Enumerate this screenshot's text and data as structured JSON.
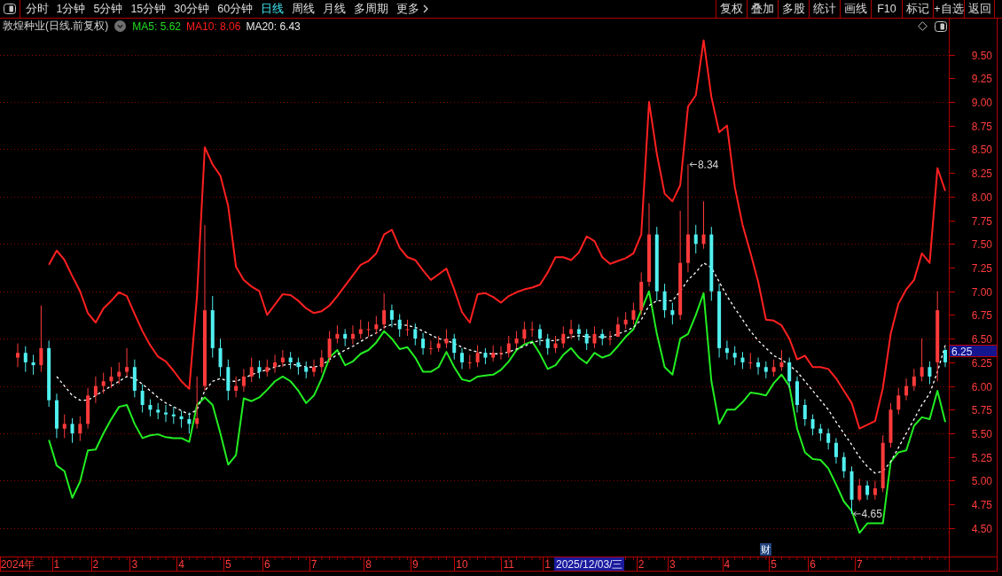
{
  "period_tabs": [
    {
      "label": "分时",
      "selected": false
    },
    {
      "label": "1分钟",
      "selected": false
    },
    {
      "label": "5分钟",
      "selected": false
    },
    {
      "label": "15分钟",
      "selected": false
    },
    {
      "label": "30分钟",
      "selected": false
    },
    {
      "label": "60分钟",
      "selected": false
    },
    {
      "label": "日线",
      "selected": true
    },
    {
      "label": "周线",
      "selected": false
    },
    {
      "label": "月线",
      "selected": false
    },
    {
      "label": "多周期",
      "selected": false
    }
  ],
  "more_menu": {
    "label": "更多"
  },
  "tool_buttons": [
    "复权",
    "叠加",
    "多股",
    "统计",
    "画线",
    "F10",
    "标记",
    "+自选",
    "返回"
  ],
  "header": {
    "title": "敦煌种业(日线.前复权)",
    "indicators": [
      {
        "label": "MA5: 5.62",
        "color": "#22dd22"
      },
      {
        "label": "MA10: 8.06",
        "color": "#ff1c1c"
      },
      {
        "label": "MA20: 6.43",
        "color": "#e8e8e8"
      }
    ]
  },
  "chart": {
    "chart_data": [
      {
        "type": "candlestick",
        "categories": [
          "2024年",
          null,
          null,
          null,
          null,
          "1",
          null,
          null,
          null,
          null,
          "2",
          null,
          null,
          null,
          null,
          "3",
          null,
          null,
          null,
          null,
          null,
          "4",
          null,
          null,
          null,
          null,
          null,
          "5",
          null,
          null,
          null,
          null,
          "6",
          null,
          null,
          null,
          null,
          null,
          "7",
          null,
          null,
          null,
          null,
          null,
          null,
          "8",
          null,
          null,
          null,
          null,
          null,
          "9",
          null,
          null,
          null,
          null,
          null,
          "10",
          null,
          null,
          null,
          null,
          null,
          "11",
          null,
          null,
          null,
          null,
          "1",
          null,
          null,
          null,
          null,
          null,
          null,
          null,
          null,
          null,
          null,
          null,
          "2",
          null,
          null,
          null,
          "3",
          null,
          null,
          null,
          null,
          null,
          null,
          "4",
          null,
          null,
          null,
          null,
          null,
          "5",
          null,
          null,
          null,
          null,
          "6",
          null,
          null,
          null,
          null,
          null,
          "7",
          null,
          null,
          null,
          null,
          null,
          null,
          null,
          null,
          null,
          null,
          null
        ],
        "ohlc": [
          [
            6.3,
            6.45,
            6.2,
            6.35
          ],
          [
            6.35,
            6.42,
            6.15,
            6.25
          ],
          [
            6.25,
            6.33,
            6.12,
            6.22
          ],
          [
            6.22,
            6.85,
            6.15,
            6.4
          ],
          [
            6.4,
            6.48,
            5.78,
            5.85
          ],
          [
            5.85,
            5.92,
            5.45,
            5.55
          ],
          [
            5.55,
            5.7,
            5.45,
            5.6
          ],
          [
            5.6,
            5.66,
            5.4,
            5.5
          ],
          [
            5.5,
            5.68,
            5.42,
            5.6
          ],
          [
            5.6,
            5.98,
            5.55,
            5.9
          ],
          [
            5.9,
            6.1,
            5.82,
            6.0
          ],
          [
            6.0,
            6.14,
            5.92,
            6.05
          ],
          [
            6.05,
            6.2,
            5.98,
            6.1
          ],
          [
            6.1,
            6.25,
            6.02,
            6.15
          ],
          [
            6.15,
            6.4,
            6.1,
            6.2
          ],
          [
            6.2,
            6.28,
            5.88,
            5.95
          ],
          [
            5.95,
            6.02,
            5.72,
            5.8
          ],
          [
            5.8,
            5.86,
            5.68,
            5.75
          ],
          [
            5.75,
            5.82,
            5.65,
            5.72
          ],
          [
            5.72,
            5.8,
            5.62,
            5.7
          ],
          [
            5.7,
            5.78,
            5.6,
            5.68
          ],
          [
            5.68,
            5.74,
            5.56,
            5.65
          ],
          [
            5.65,
            5.72,
            5.5,
            5.6
          ],
          [
            5.6,
            6.1,
            5.55,
            5.66
          ],
          [
            6.0,
            7.7,
            5.95,
            6.8
          ],
          [
            6.8,
            6.95,
            6.3,
            6.4
          ],
          [
            6.4,
            6.5,
            6.1,
            6.2
          ],
          [
            6.2,
            6.28,
            5.85,
            5.95
          ],
          [
            5.95,
            6.1,
            5.88,
            6.0
          ],
          [
            6.0,
            6.18,
            5.94,
            6.1
          ],
          [
            6.1,
            6.3,
            6.04,
            6.2
          ],
          [
            6.2,
            6.27,
            6.08,
            6.15
          ],
          [
            6.15,
            6.28,
            6.1,
            6.2
          ],
          [
            6.2,
            6.33,
            6.14,
            6.25
          ],
          [
            6.25,
            6.38,
            6.2,
            6.3
          ],
          [
            6.3,
            6.36,
            6.18,
            6.25
          ],
          [
            6.25,
            6.3,
            6.12,
            6.2
          ],
          [
            6.2,
            6.26,
            6.08,
            6.15
          ],
          [
            6.15,
            6.28,
            6.1,
            6.2
          ],
          [
            6.2,
            6.38,
            6.14,
            6.3
          ],
          [
            6.3,
            6.58,
            6.25,
            6.5
          ],
          [
            6.5,
            6.64,
            6.45,
            6.55
          ],
          [
            6.55,
            6.6,
            6.42,
            6.5
          ],
          [
            6.5,
            6.64,
            6.44,
            6.55
          ],
          [
            6.55,
            6.7,
            6.5,
            6.6
          ],
          [
            6.6,
            6.68,
            6.52,
            6.6
          ],
          [
            6.6,
            6.74,
            6.55,
            6.65
          ],
          [
            6.65,
            6.98,
            6.6,
            6.8
          ],
          [
            6.8,
            6.86,
            6.62,
            6.7
          ],
          [
            6.7,
            6.76,
            6.52,
            6.6
          ],
          [
            6.6,
            6.7,
            6.53,
            6.6
          ],
          [
            6.6,
            6.66,
            6.43,
            6.5
          ],
          [
            6.5,
            6.56,
            6.33,
            6.4
          ],
          [
            6.4,
            6.48,
            6.33,
            6.4
          ],
          [
            6.4,
            6.53,
            6.36,
            6.45
          ],
          [
            6.45,
            6.6,
            6.4,
            6.5
          ],
          [
            6.5,
            6.55,
            6.28,
            6.35
          ],
          [
            6.35,
            6.4,
            6.18,
            6.25
          ],
          [
            6.25,
            6.33,
            6.18,
            6.25
          ],
          [
            6.25,
            6.43,
            6.2,
            6.35
          ],
          [
            6.35,
            6.4,
            6.23,
            6.3
          ],
          [
            6.3,
            6.43,
            6.26,
            6.35
          ],
          [
            6.35,
            6.42,
            6.28,
            6.35
          ],
          [
            6.35,
            6.53,
            6.3,
            6.45
          ],
          [
            6.45,
            6.58,
            6.4,
            6.5
          ],
          [
            6.5,
            6.68,
            6.45,
            6.6
          ],
          [
            6.6,
            6.68,
            6.52,
            6.6
          ],
          [
            6.6,
            6.65,
            6.43,
            6.5
          ],
          [
            6.5,
            6.55,
            6.33,
            6.4
          ],
          [
            6.4,
            6.53,
            6.35,
            6.45
          ],
          [
            6.45,
            6.63,
            6.4,
            6.55
          ],
          [
            6.55,
            6.7,
            6.5,
            6.6
          ],
          [
            6.6,
            6.65,
            6.48,
            6.55
          ],
          [
            6.55,
            6.6,
            6.38,
            6.45
          ],
          [
            6.45,
            6.63,
            6.4,
            6.55
          ],
          [
            6.55,
            6.6,
            6.43,
            6.5
          ],
          [
            6.5,
            6.58,
            6.43,
            6.5
          ],
          [
            6.52,
            6.73,
            6.52,
            6.65
          ],
          [
            6.65,
            6.78,
            6.6,
            6.7
          ],
          [
            6.7,
            6.88,
            6.65,
            6.8
          ],
          [
            6.8,
            7.2,
            6.75,
            7.1
          ],
          [
            7.1,
            7.93,
            7.05,
            7.6
          ],
          [
            7.6,
            7.68,
            6.9,
            7.0
          ],
          [
            7.0,
            7.08,
            6.72,
            6.8
          ],
          [
            6.8,
            6.88,
            6.65,
            6.75
          ],
          [
            6.75,
            7.85,
            6.7,
            7.3
          ],
          [
            7.3,
            8.34,
            7.2,
            7.6
          ],
          [
            7.6,
            7.7,
            7.4,
            7.5
          ],
          [
            7.5,
            7.95,
            7.45,
            7.6
          ],
          [
            7.6,
            7.68,
            6.9,
            7.0
          ],
          [
            7.0,
            7.08,
            6.3,
            6.4
          ],
          [
            6.4,
            6.48,
            6.28,
            6.35
          ],
          [
            6.35,
            6.42,
            6.22,
            6.3
          ],
          [
            6.3,
            6.36,
            6.18,
            6.25
          ],
          [
            6.25,
            6.35,
            6.18,
            6.25
          ],
          [
            6.25,
            6.3,
            6.12,
            6.2
          ],
          [
            6.2,
            6.26,
            6.08,
            6.15
          ],
          [
            6.15,
            6.28,
            6.1,
            6.2
          ],
          [
            6.2,
            6.38,
            6.16,
            6.25
          ],
          [
            6.25,
            6.3,
            5.98,
            6.05
          ],
          [
            6.05,
            6.1,
            5.72,
            5.8
          ],
          [
            5.8,
            5.86,
            5.58,
            5.65
          ],
          [
            5.65,
            5.7,
            5.48,
            5.55
          ],
          [
            5.55,
            5.6,
            5.42,
            5.5
          ],
          [
            5.5,
            5.55,
            5.33,
            5.4
          ],
          [
            5.4,
            5.45,
            5.18,
            5.25
          ],
          [
            5.25,
            5.3,
            5.03,
            5.1
          ],
          [
            5.1,
            5.15,
            4.65,
            4.8
          ],
          [
            4.8,
            5.02,
            4.78,
            4.95
          ],
          [
            4.95,
            5.0,
            4.8,
            4.85
          ],
          [
            4.85,
            5.0,
            4.8,
            4.92
          ],
          [
            4.92,
            5.48,
            4.88,
            5.4
          ],
          [
            5.4,
            5.82,
            5.35,
            5.75
          ],
          [
            5.75,
            5.98,
            5.7,
            5.9
          ],
          [
            5.9,
            6.08,
            5.85,
            6.0
          ],
          [
            6.0,
            6.18,
            5.95,
            6.1
          ],
          [
            6.1,
            6.5,
            6.05,
            6.2
          ],
          [
            6.2,
            6.26,
            6.02,
            6.1
          ],
          [
            6.25,
            7.0,
            6.05,
            6.8
          ],
          [
            6.38,
            6.4,
            6.2,
            6.25
          ]
        ],
        "series": [
          {
            "type": "line",
            "color": "#22ee22",
            "values": [
              null,
              null,
              null,
              null,
              5.43,
              5.16,
              5.1,
              4.82,
              4.99,
              5.32,
              5.33,
              5.5,
              5.65,
              5.78,
              5.8,
              5.6,
              5.45,
              5.48,
              5.49,
              5.46,
              5.45,
              5.45,
              5.41,
              5.8,
              5.88,
              5.8,
              5.5,
              5.17,
              5.27,
              5.87,
              5.84,
              5.88,
              5.96,
              6.05,
              6.1,
              6.05,
              5.95,
              5.82,
              5.9,
              6.08,
              6.3,
              6.38,
              6.22,
              6.26,
              6.34,
              6.38,
              6.46,
              6.58,
              6.5,
              6.39,
              6.41,
              6.3,
              6.15,
              6.15,
              6.2,
              6.36,
              6.2,
              6.07,
              6.05,
              6.1,
              6.11,
              6.12,
              6.17,
              6.26,
              6.38,
              6.44,
              6.47,
              6.34,
              6.18,
              6.22,
              6.33,
              6.4,
              6.3,
              6.24,
              6.35,
              6.3,
              6.33,
              6.42,
              6.52,
              6.6,
              6.8,
              7.0,
              6.55,
              6.2,
              6.12,
              6.5,
              6.55,
              6.75,
              6.98,
              6.05,
              5.6,
              5.75,
              5.75,
              5.83,
              5.93,
              5.92,
              5.9,
              6.03,
              6.12,
              6.0,
              5.55,
              5.3,
              5.23,
              5.22,
              5.13,
              4.96,
              4.78,
              4.68,
              4.45,
              4.55,
              4.55,
              4.55,
              5.2,
              5.3,
              5.32,
              5.58,
              5.67,
              5.65,
              5.95,
              5.62
            ]
          },
          {
            "type": "line",
            "color": "#ff2020",
            "values": [
              null,
              null,
              null,
              null,
              7.28,
              7.43,
              7.33,
              7.16,
              7.0,
              6.77,
              6.67,
              6.82,
              6.9,
              6.99,
              6.95,
              6.76,
              6.58,
              6.43,
              6.31,
              6.26,
              6.16,
              6.05,
              5.97,
              6.95,
              8.52,
              8.34,
              8.22,
              7.9,
              7.26,
              7.12,
              7.05,
              7.0,
              6.75,
              6.86,
              6.97,
              6.96,
              6.9,
              6.82,
              6.77,
              6.79,
              6.85,
              6.95,
              7.06,
              7.17,
              7.28,
              7.32,
              7.4,
              7.6,
              7.65,
              7.46,
              7.36,
              7.33,
              7.22,
              7.12,
              7.18,
              7.24,
              7.02,
              6.78,
              6.67,
              6.97,
              6.98,
              6.94,
              6.88,
              6.95,
              6.99,
              7.02,
              7.04,
              7.07,
              7.2,
              7.36,
              7.36,
              7.33,
              7.41,
              7.58,
              7.53,
              7.36,
              7.29,
              7.32,
              7.35,
              7.4,
              7.6,
              9.0,
              8.45,
              8.03,
              7.95,
              8.12,
              8.95,
              9.07,
              9.65,
              9.05,
              8.68,
              8.75,
              8.1,
              7.7,
              7.41,
              7.1,
              6.7,
              6.69,
              6.64,
              6.5,
              6.28,
              6.32,
              6.2,
              6.2,
              6.18,
              6.08,
              5.95,
              5.82,
              5.55,
              5.59,
              5.63,
              5.98,
              6.55,
              6.87,
              7.02,
              7.12,
              7.4,
              7.3,
              8.3,
              8.06
            ]
          },
          {
            "type": "line",
            "color": "#ffffff",
            "line_style": "dashed",
            "values": [
              null,
              null,
              null,
              null,
              null,
              6.1,
              6.0,
              5.9,
              5.85,
              5.85,
              5.9,
              5.95,
              6.0,
              6.05,
              6.1,
              6.08,
              6.02,
              5.95,
              5.88,
              5.82,
              5.78,
              5.74,
              5.7,
              5.75,
              5.95,
              6.05,
              6.08,
              6.05,
              6.05,
              6.08,
              6.12,
              6.15,
              6.17,
              6.2,
              6.22,
              6.23,
              6.22,
              6.2,
              6.2,
              6.22,
              6.28,
              6.33,
              6.38,
              6.42,
              6.47,
              6.52,
              6.56,
              6.62,
              6.65,
              6.65,
              6.64,
              6.62,
              6.58,
              6.54,
              6.5,
              6.48,
              6.45,
              6.41,
              6.38,
              6.36,
              6.34,
              6.34,
              6.34,
              6.36,
              6.39,
              6.42,
              6.46,
              6.48,
              6.48,
              6.48,
              6.5,
              6.52,
              6.53,
              6.52,
              6.52,
              6.52,
              6.52,
              6.55,
              6.58,
              6.62,
              6.7,
              6.85,
              6.9,
              6.9,
              6.9,
              7.0,
              7.12,
              7.2,
              7.3,
              7.25,
              7.1,
              6.95,
              6.82,
              6.7,
              6.58,
              6.48,
              6.4,
              6.32,
              6.28,
              6.22,
              6.15,
              6.05,
              5.95,
              5.85,
              5.75,
              5.62,
              5.5,
              5.38,
              5.25,
              5.15,
              5.08,
              5.1,
              5.2,
              5.35,
              5.5,
              5.65,
              5.8,
              5.92,
              6.15,
              6.43
            ]
          }
        ],
        "ylim": [
          4.2,
          9.72
        ],
        "yticks": [
          {
            "value": 4.5,
            "label": "4.50"
          },
          {
            "value": 4.75,
            "label": "4.75"
          },
          {
            "value": 5.0,
            "label": "5.00"
          },
          {
            "value": 5.25,
            "label": "5.25"
          },
          {
            "value": 5.5,
            "label": "5.50"
          },
          {
            "value": 5.75,
            "label": "5.75"
          },
          {
            "value": 6.0,
            "label": "6.00"
          },
          {
            "value": 6.25,
            "label": "6.25"
          },
          {
            "value": 6.5,
            "label": "6.50"
          },
          {
            "value": 6.75,
            "label": "6.75"
          },
          {
            "value": 7.0,
            "label": "7.00"
          },
          {
            "value": 7.25,
            "label": "7.25"
          },
          {
            "value": 7.5,
            "label": "7.50"
          },
          {
            "value": 7.75,
            "label": "7.75"
          },
          {
            "value": 8.0,
            "label": "8.00"
          },
          {
            "value": 8.25,
            "label": "8.25"
          },
          {
            "value": 8.5,
            "label": "8.50"
          },
          {
            "value": 8.75,
            "label": "8.75"
          },
          {
            "value": 9.0,
            "label": "9.00"
          },
          {
            "value": 9.25,
            "label": "9.25"
          },
          {
            "value": 9.5,
            "label": "9.50"
          }
        ],
        "grid": true,
        "annotations": [
          "8.34",
          "4.65"
        ]
      }
    ],
    "current_price": "6.25",
    "cursor_date": "2025/12/03/三",
    "event_marker": "财"
  }
}
